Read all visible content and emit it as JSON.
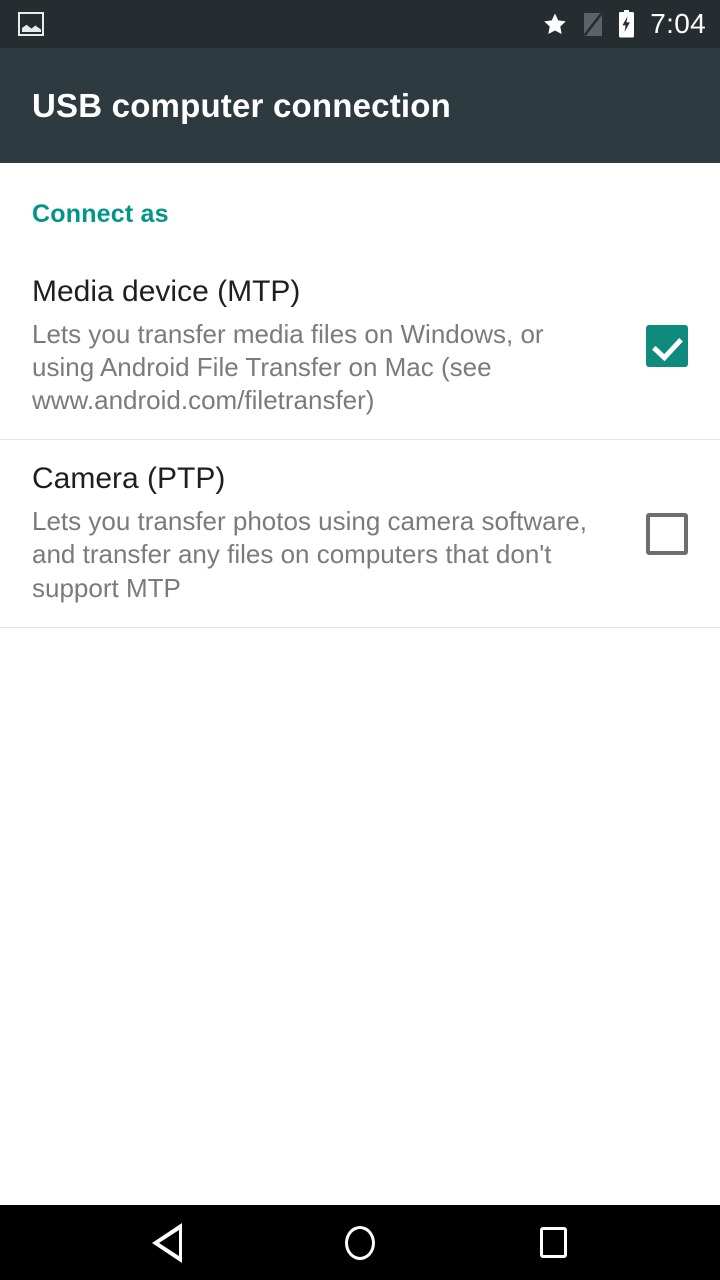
{
  "status_bar": {
    "notification_icon": "gallery-icon",
    "icons": [
      "star-icon",
      "no-sim-icon",
      "battery-charging-icon"
    ],
    "time": "7:04",
    "background_color": "#262d31"
  },
  "app_bar": {
    "title": "USB computer connection",
    "background_color": "#2d3a40"
  },
  "content": {
    "section_header": "Connect as",
    "accent_color": "#009688",
    "options": [
      {
        "title": "Media device (MTP)",
        "summary": "Lets you transfer media files on Windows, or using Android File Transfer on Mac (see www.android.com/filetransfer)",
        "checked": true,
        "checkbox_color": "#0f8b7e"
      },
      {
        "title": "Camera (PTP)",
        "summary": "Lets you transfer photos using camera software, and transfer any files on computers that don't support MTP",
        "checked": false,
        "checkbox_color": "#6e6e6e"
      }
    ]
  },
  "nav_bar": {
    "back_label": "Back",
    "home_label": "Home",
    "recents_label": "Recents",
    "background_color": "#000000"
  }
}
